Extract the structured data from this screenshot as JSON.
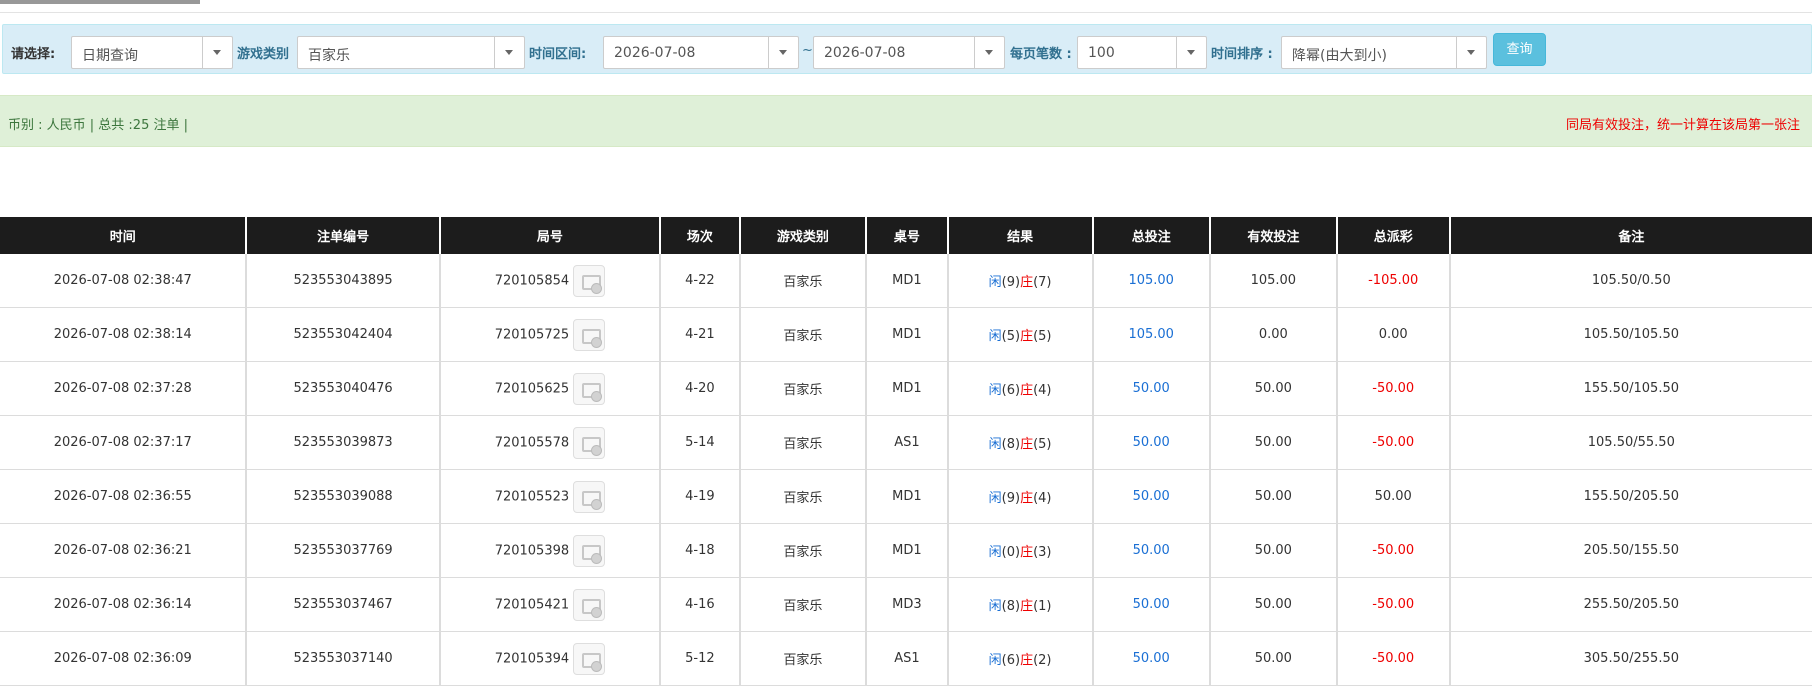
{
  "filters": {
    "select_label": "请选择:",
    "query_type": "日期查询",
    "game_label": "游戏类别",
    "game_value": "百家乐",
    "range_label": "时间区间:",
    "date_from": "2026-07-08",
    "range_sep": "~",
    "date_to": "2026-07-08",
    "per_page_label": "每页笔数 :",
    "per_page_value": "100",
    "sort_label": "时间排序 :",
    "sort_value": "降幂(由大到小)",
    "query_button": "查询"
  },
  "summary": {
    "left": "币别 : 人民币 | 总共 :25 注单 |",
    "right": "同局有效投注，统一计算在该局第一张注"
  },
  "colors": {
    "blue": "#1a6fd4",
    "red": "#ee0000",
    "header_bg": "#1c1c1c",
    "info_bg": "#d9edf7",
    "success_bg": "#dff0d8"
  },
  "table": {
    "headers": [
      "时间",
      "注单编号",
      "局号",
      "场次",
      "游戏类别",
      "桌号",
      "结果",
      "总投注",
      "有效投注",
      "总派彩",
      "备注"
    ],
    "rows": [
      {
        "time": "2026-07-08 02:38:47",
        "bet_id": "523553043895",
        "round": "720105854",
        "session": "4-22",
        "game": "百家乐",
        "table": "MD1",
        "player_label": "闲",
        "player_score": "(9)",
        "banker_label": "庄",
        "banker_score": "(7)",
        "total_bet": "105.00",
        "valid_bet": "105.00",
        "payout": "-105.00",
        "payout_negative": true,
        "note": "105.50/0.50"
      },
      {
        "time": "2026-07-08 02:38:14",
        "bet_id": "523553042404",
        "round": "720105725",
        "session": "4-21",
        "game": "百家乐",
        "table": "MD1",
        "player_label": "闲",
        "player_score": "(5)",
        "banker_label": "庄",
        "banker_score": "(5)",
        "total_bet": "105.00",
        "valid_bet": "0.00",
        "payout": "0.00",
        "payout_negative": false,
        "note": "105.50/105.50"
      },
      {
        "time": "2026-07-08 02:37:28",
        "bet_id": "523553040476",
        "round": "720105625",
        "session": "4-20",
        "game": "百家乐",
        "table": "MD1",
        "player_label": "闲",
        "player_score": "(6)",
        "banker_label": "庄",
        "banker_score": "(4)",
        "total_bet": "50.00",
        "valid_bet": "50.00",
        "payout": "-50.00",
        "payout_negative": true,
        "note": "155.50/105.50"
      },
      {
        "time": "2026-07-08 02:37:17",
        "bet_id": "523553039873",
        "round": "720105578",
        "session": "5-14",
        "game": "百家乐",
        "table": "AS1",
        "player_label": "闲",
        "player_score": "(8)",
        "banker_label": "庄",
        "banker_score": "(5)",
        "total_bet": "50.00",
        "valid_bet": "50.00",
        "payout": "-50.00",
        "payout_negative": true,
        "note": "105.50/55.50"
      },
      {
        "time": "2026-07-08 02:36:55",
        "bet_id": "523553039088",
        "round": "720105523",
        "session": "4-19",
        "game": "百家乐",
        "table": "MD1",
        "player_label": "闲",
        "player_score": "(9)",
        "banker_label": "庄",
        "banker_score": "(4)",
        "total_bet": "50.00",
        "valid_bet": "50.00",
        "payout": "50.00",
        "payout_negative": false,
        "note": "155.50/205.50"
      },
      {
        "time": "2026-07-08 02:36:21",
        "bet_id": "523553037769",
        "round": "720105398",
        "session": "4-18",
        "game": "百家乐",
        "table": "MD1",
        "player_label": "闲",
        "player_score": "(0)",
        "banker_label": "庄",
        "banker_score": "(3)",
        "total_bet": "50.00",
        "valid_bet": "50.00",
        "payout": "-50.00",
        "payout_negative": true,
        "note": "205.50/155.50"
      },
      {
        "time": "2026-07-08 02:36:14",
        "bet_id": "523553037467",
        "round": "720105421",
        "session": "4-16",
        "game": "百家乐",
        "table": "MD3",
        "player_label": "闲",
        "player_score": "(8)",
        "banker_label": "庄",
        "banker_score": "(1)",
        "total_bet": "50.00",
        "valid_bet": "50.00",
        "payout": "-50.00",
        "payout_negative": true,
        "note": "255.50/205.50"
      },
      {
        "time": "2026-07-08 02:36:09",
        "bet_id": "523553037140",
        "round": "720105394",
        "session": "5-12",
        "game": "百家乐",
        "table": "AS1",
        "player_label": "闲",
        "player_score": "(6)",
        "banker_label": "庄",
        "banker_score": "(2)",
        "total_bet": "50.00",
        "valid_bet": "50.00",
        "payout": "-50.00",
        "payout_negative": true,
        "note": "305.50/255.50"
      }
    ]
  }
}
